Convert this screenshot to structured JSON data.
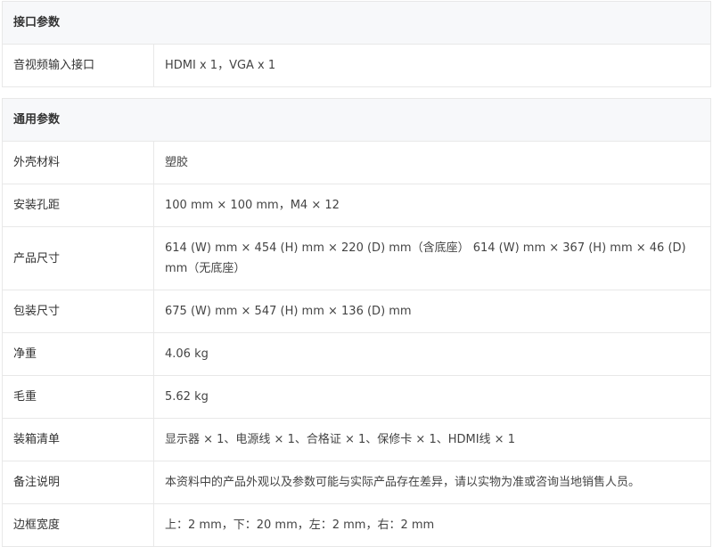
{
  "interface_section": {
    "title": "接口参数",
    "rows": [
      {
        "label": "音视频输入接口",
        "value": "HDMI x 1，VGA x 1"
      }
    ]
  },
  "general_section": {
    "title": "通用参数",
    "rows": [
      {
        "label": "外壳材料",
        "value": "塑胶"
      },
      {
        "label": "安装孔距",
        "value": "100 mm × 100 mm，M4 × 12"
      },
      {
        "label": "产品尺寸",
        "value": "614 (W) mm × 454 (H) mm × 220 (D) mm（含底座） 614 (W) mm × 367 (H) mm × 46 (D) mm（无底座）"
      },
      {
        "label": "包装尺寸",
        "value": "675 (W) mm × 547 (H) mm × 136 (D) mm"
      },
      {
        "label": "净重",
        "value": "4.06 kg"
      },
      {
        "label": "毛重",
        "value": "5.62 kg"
      },
      {
        "label": "装箱清单",
        "value": "显示器 × 1、电源线 × 1、合格证 × 1、保修卡 × 1、HDMI线 × 1"
      },
      {
        "label": "备注说明",
        "value": "本资料中的产品外观以及参数可能与实际产品存在差异，请以实物为准或咨询当地销售人员。"
      },
      {
        "label": "边框宽度",
        "value": "上：2 mm，下：20 mm，左：2 mm，右：2 mm"
      }
    ]
  }
}
